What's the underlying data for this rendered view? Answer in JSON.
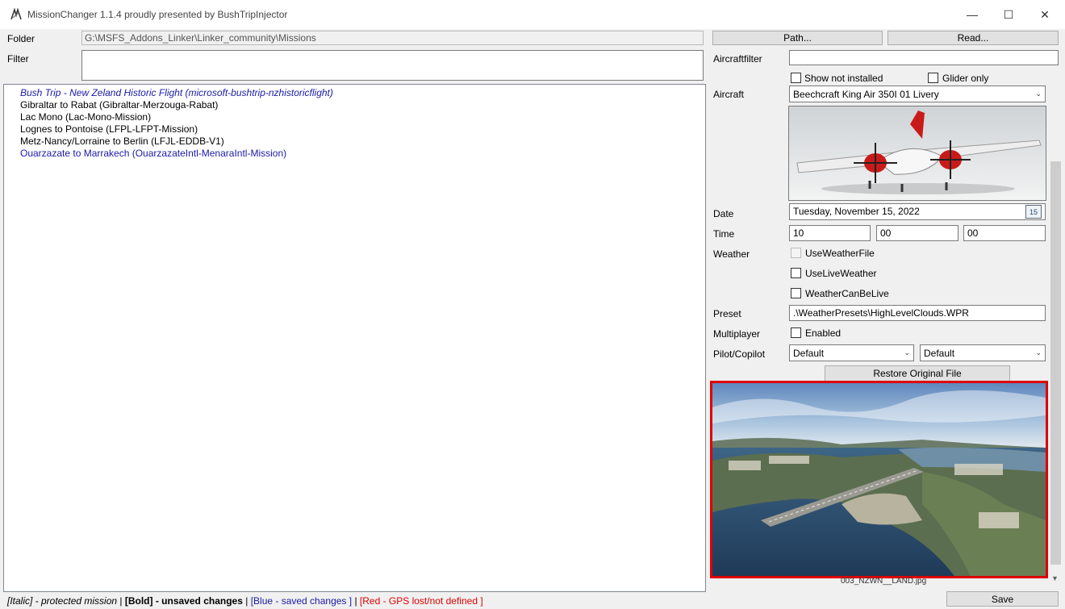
{
  "window": {
    "title": "MissionChanger 1.1.4 proudly presented by BushTripInjector",
    "minimize_glyph": "—",
    "maximize_glyph": "☐",
    "close_glyph": "✕"
  },
  "folder": {
    "label": "Folder",
    "value": "G:\\MSFS_Addons_Linker\\Linker_community\\Missions"
  },
  "filter": {
    "label": "Filter",
    "value": ""
  },
  "buttons": {
    "path": "Path...",
    "read": "Read...",
    "restore": "Restore Original File",
    "save": "Save"
  },
  "missions": [
    {
      "text": "Bush Trip - New Zeland Historic Flight (microsoft-bushtrip-nzhistoricflight)",
      "italic": true,
      "color": "#1a1aa8"
    },
    {
      "text": "Gibraltar to Rabat (Gibraltar-Merzouga-Rabat)",
      "italic": false,
      "color": "#000000"
    },
    {
      "text": "Lac Mono (Lac-Mono-Mission)",
      "italic": false,
      "color": "#000000"
    },
    {
      "text": "Lognes to Pontoise (LFPL-LFPT-Mission)",
      "italic": false,
      "color": "#000000"
    },
    {
      "text": "Metz-Nancy/Lorraine to Berlin (LFJL-EDDB-V1)",
      "italic": false,
      "color": "#000000"
    },
    {
      "text": "Ouarzazate to Marrakech (OuarzazateIntl-MenaraIntl-Mission)",
      "italic": false,
      "color": "#1a1aa8"
    }
  ],
  "aircraftfilter": {
    "label": "Aircraftfilter",
    "value": ""
  },
  "show_not_installed": {
    "label": "Show not installed",
    "checked": false
  },
  "glider_only": {
    "label": "Glider only",
    "checked": false
  },
  "aircraft": {
    "label": "Aircraft",
    "value": "Beechcraft King Air 350I 01 Livery"
  },
  "date": {
    "label": "Date",
    "value": "Tuesday, November 15, 2022",
    "calendar_day": "15"
  },
  "time": {
    "label": "Time",
    "hours": "10",
    "minutes": "00",
    "seconds": "00"
  },
  "weather": {
    "label": "Weather",
    "use_weather_file": {
      "label": "UseWeatherFile",
      "checked": false,
      "disabled": true
    },
    "use_live_weather": {
      "label": "UseLiveWeather",
      "checked": false
    },
    "weather_can_be_live": {
      "label": "WeatherCanBeLive",
      "checked": false
    }
  },
  "preset": {
    "label": "Preset",
    "value": ".\\WeatherPresets\\HighLevelClouds.WPR"
  },
  "multiplayer": {
    "label": "Multiplayer",
    "enabled_label": "Enabled",
    "checked": false
  },
  "pilot_copilot": {
    "label": "Pilot/Copilot",
    "pilot": "Default",
    "copilot": "Default"
  },
  "mission_image": {
    "caption": "003_NZWN__LAND.jpg",
    "border_color": "#e00000"
  },
  "legend": {
    "italic": "[Italic] - protected mission",
    "sep1": " | ",
    "bold": "[Bold] - unsaved changes",
    "sep2": " | ",
    "blue": "[Blue - saved changes ]",
    "sep3": " | ",
    "red": "[Red - GPS lost/not defined ]",
    "blue_color": "#1a1aa8",
    "red_color": "#e00000"
  }
}
